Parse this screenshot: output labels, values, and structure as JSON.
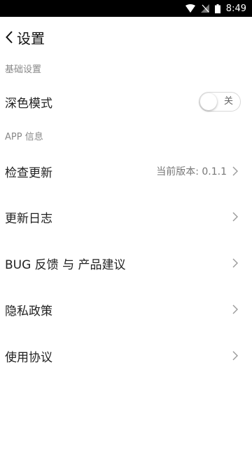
{
  "status_bar": {
    "time": "8:49"
  },
  "header": {
    "title": "设置"
  },
  "sections": {
    "basic": {
      "label": "基础设置",
      "dark_mode": {
        "label": "深色模式",
        "toggle_state": "关",
        "enabled": false
      }
    },
    "app_info": {
      "label": "APP 信息",
      "check_update": {
        "label": "检查更新",
        "value": "当前版本: 0.1.1"
      },
      "changelog": {
        "label": "更新日志"
      },
      "feedback": {
        "label": "BUG 反馈 与 产品建议"
      },
      "privacy": {
        "label": "隐私政策"
      },
      "terms": {
        "label": "使用协议"
      }
    }
  },
  "colors": {
    "status_bar_bg": "#000000",
    "background": "#ffffff",
    "secondary_text": "#888888"
  }
}
